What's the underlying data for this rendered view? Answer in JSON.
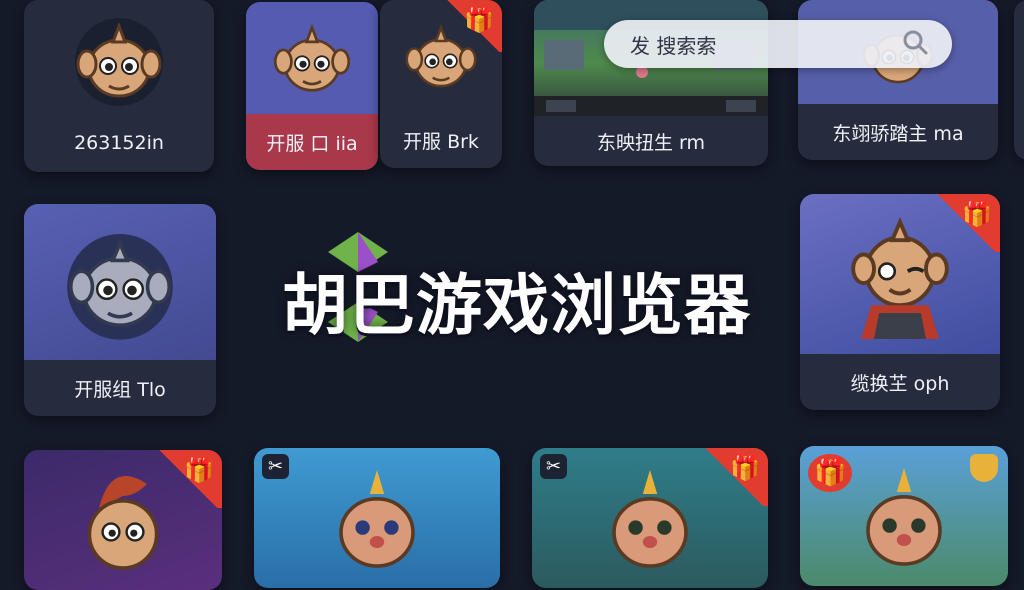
{
  "app": {
    "title": "胡巴游戏浏览器"
  },
  "search": {
    "text": "发 搜索索"
  },
  "cards": [
    {
      "label": "263152in"
    },
    {
      "label": "开服 口 iia"
    },
    {
      "label": "开服 Brk"
    },
    {
      "label": "东映扭生 rm"
    },
    {
      "label": "东翊骄踏主 ma"
    },
    {
      "label": "开服组 Tlo"
    },
    {
      "label": "缆换芏 oph"
    }
  ],
  "icons": {
    "gift": "🎁",
    "tools": "✂"
  },
  "colors": {
    "background": "#151a29",
    "card": "#262c3d",
    "accent_red": "#e23b2f",
    "accent_blue": "#5b64b8",
    "label_red": "#a9384a"
  }
}
